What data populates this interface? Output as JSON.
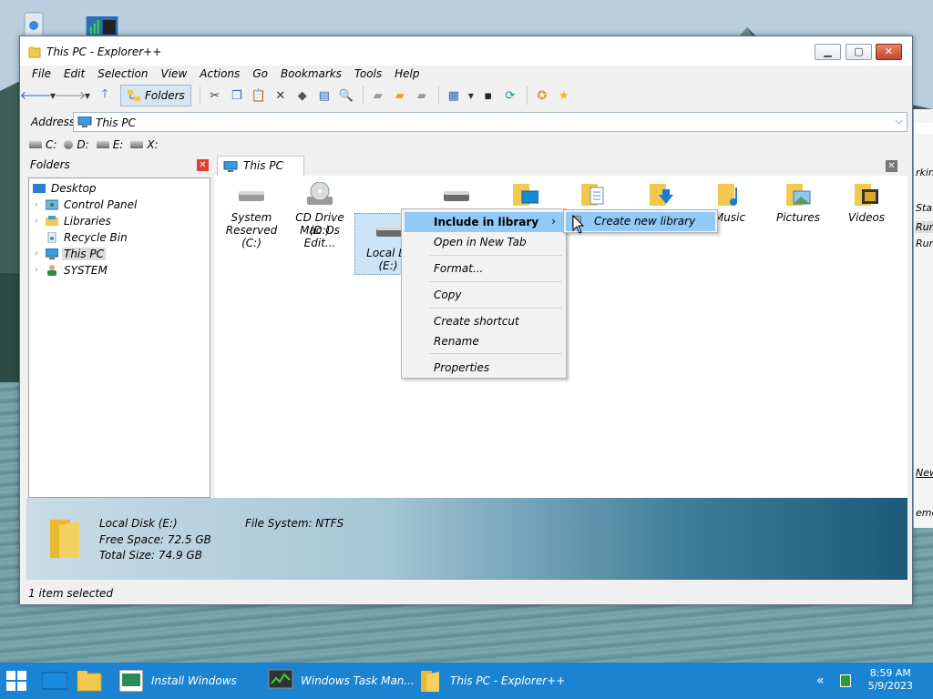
{
  "window": {
    "title": "This PC - Explorer++"
  },
  "menu": [
    "File",
    "Edit",
    "Selection",
    "View",
    "Actions",
    "Go",
    "Bookmarks",
    "Tools",
    "Help"
  ],
  "toolbar": {
    "folders_label": "Folders"
  },
  "address": {
    "label": "Address",
    "value": "This PC"
  },
  "drives": [
    "C:",
    "D:",
    "E:",
    "X:"
  ],
  "folders_pane": {
    "title": "Folders",
    "tree": [
      {
        "label": "Desktop",
        "icon": "desktop-icon"
      },
      {
        "label": "Control Panel",
        "icon": "control-panel-icon"
      },
      {
        "label": "Libraries",
        "icon": "libraries-icon"
      },
      {
        "label": "Recycle Bin",
        "icon": "recycle-bin-icon"
      },
      {
        "label": "This PC",
        "icon": "computer-icon"
      },
      {
        "label": "SYSTEM",
        "icon": "user-icon"
      }
    ]
  },
  "tab": {
    "label": "This PC"
  },
  "files": [
    {
      "line1": "System",
      "line2": "Reserved (C:)",
      "icon": "hard-drive-icon"
    },
    {
      "line1": "CD Drive (D:)",
      "line2": "Mac Os Edit...",
      "icon": "cd-drive-icon"
    },
    {
      "line1": "Local Di",
      "line2": "(E:)",
      "icon": "hard-drive-icon"
    },
    {
      "line1": "",
      "line2": "",
      "icon": "hard-drive-icon"
    },
    {
      "line1": "",
      "line2": "",
      "icon": "desktop-folder-icon"
    },
    {
      "line1": "",
      "line2": "",
      "icon": "documents-folder-icon"
    },
    {
      "line1": "",
      "line2": "",
      "icon": "downloads-folder-icon"
    },
    {
      "line1": "Music",
      "line2": "",
      "icon": "music-folder-icon"
    },
    {
      "line1": "Pictures",
      "line2": "",
      "icon": "pictures-folder-icon"
    },
    {
      "line1": "Videos",
      "line2": "",
      "icon": "videos-folder-icon"
    }
  ],
  "context_menu": {
    "items": [
      "Include in library",
      "Open in New Tab",
      "Format...",
      "Copy",
      "Create shortcut",
      "Rename",
      "Properties"
    ],
    "submenu_item": "Create new library"
  },
  "info": {
    "name": "Local Disk (E:)",
    "free": "Free Space: 72.5 GB",
    "total": "Total Size: 74.9 GB",
    "fs": "File System: NTFS"
  },
  "status": "1 item selected",
  "bg_window": {
    "frag1": "rking",
    "frag2": "Stat",
    "frag3": "Run",
    "frag4": "Run",
    "frag5": "New",
    "frag6": "emor"
  },
  "taskbar": {
    "tasks": [
      "Install Windows",
      "Windows Task Man...",
      "This PC - Explorer++"
    ],
    "time": "8:59 AM",
    "date": "5/9/2023"
  },
  "colors": {
    "taskbar": "#1b84d2",
    "menu_highlight": "#91c9f7",
    "selection": "#cce4f7"
  }
}
